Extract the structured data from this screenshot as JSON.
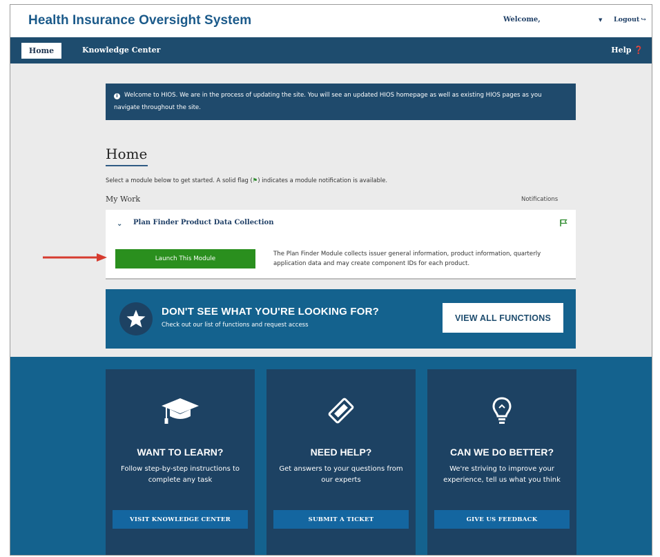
{
  "header": {
    "site_title": "Health Insurance Oversight System",
    "welcome": "Welcome,",
    "logout": "Logout"
  },
  "nav": {
    "home": "Home",
    "knowledge_center": "Knowledge Center",
    "help": "Help"
  },
  "alert": {
    "text": "Welcome to HIOS. We are in the process of updating the site. You will see an updated HIOS homepage as well as existing HIOS pages as you navigate throughout the site."
  },
  "page": {
    "title": "Home",
    "intro_before": "Select a module below to get started. A solid flag (",
    "intro_after": ") indicates a module notification is available.",
    "my_work": "My Work",
    "notifications": "Notifications"
  },
  "module": {
    "name": "Plan Finder Product Data Collection",
    "launch": "Launch This Module",
    "description": "The Plan Finder Module collects issuer general information, product information, quarterly application data and may create component IDs for each product."
  },
  "cta": {
    "title": "DON'T SEE WHAT YOU'RE LOOKING FOR?",
    "subtitle": "Check out our list of functions and request access",
    "button": "VIEW ALL FUNCTIONS"
  },
  "cards": [
    {
      "icon": "graduation-cap-icon",
      "title": "WANT TO LEARN?",
      "text": "Follow step-by-step instructions to complete any task",
      "button": "VISIT KNOWLEDGE CENTER"
    },
    {
      "icon": "ticket-icon",
      "title": "NEED HELP?",
      "text": "Get answers to your questions from our experts",
      "button": "SUBMIT A TICKET"
    },
    {
      "icon": "lightbulb-icon",
      "title": "CAN WE DO BETTER?",
      "text": "We're striving to improve your experience, tell us what you think",
      "button": "GIVE US FEEDBACK"
    }
  ],
  "colors": {
    "nav": "#1e4c6e",
    "alert": "#1f4a6c",
    "launch": "#2a8f1e",
    "cta": "#14628e",
    "card": "#1d4263",
    "flag": "#2e8b2e",
    "arrow": "#d63b2f"
  }
}
